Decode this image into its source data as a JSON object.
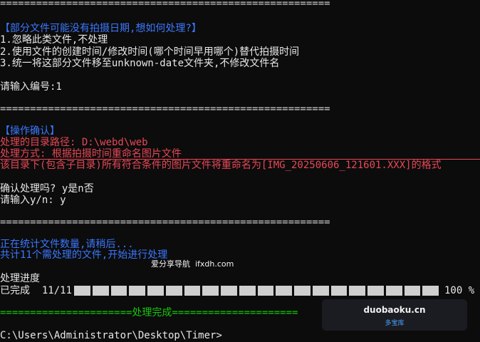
{
  "separator": "=======================================================",
  "question": {
    "title": "【部分文件可能没有拍摄日期,想如何处理?】",
    "options": [
      "1.忽略此类文件,不处理",
      "2.使用文件的创建时间/修改时间(哪个时间早用哪个)替代拍摄时间",
      "3.统一将这部分文件移至unknown-date文件夹,不修改文件名"
    ],
    "prompt": "请输入编号:1"
  },
  "confirm": {
    "title": "【操作确认】",
    "dir_line": "处理的目录路径: D:\\webd\\web",
    "mode_line": "处理方式: 根据拍摄时间重命名图片文件",
    "desc_line": "该目录下(包含子目录)所有符合条件的图片文件将重命名为[IMG_20250606_121601.XXX]的格式",
    "ask_line": "确认处理吗? y是n否",
    "input_line": "请输入y/n: y"
  },
  "status": {
    "counting": "正在统计文件数量,请稍后...",
    "found": "共计11个需处理的文件,开始进行处理"
  },
  "progress": {
    "label": "处理进度",
    "done_text": "已完成  11/11",
    "percent_text": "100 %",
    "fraction": 1.0,
    "cells": 20
  },
  "done_line": "======================处理完成=====================",
  "prompt_line": "C:\\Users\\Administrator\\Desktop\\Timer>",
  "watermarks": {
    "site1": "爱分享导航  ifxdh.com",
    "site2_main": "duobaoku.cn",
    "site2_sub": "多宝库"
  },
  "colors": {
    "background": "#0c0c0c",
    "blue": "#3b78ff",
    "red": "#e74856",
    "green": "#16c60c"
  }
}
